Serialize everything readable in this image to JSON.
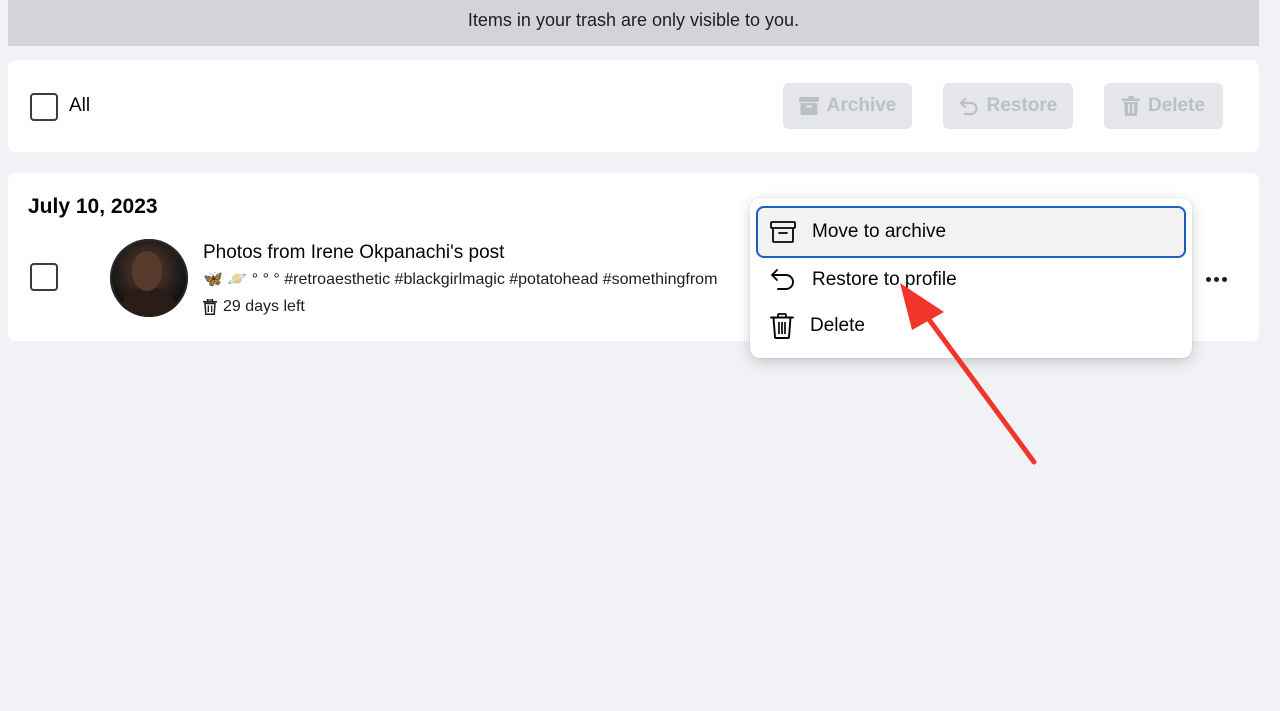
{
  "notice": "Items in your trash are only visible to you.",
  "toolbar": {
    "select_all_label": "All",
    "archive_label": "Archive",
    "restore_label": "Restore",
    "delete_label": "Delete"
  },
  "group": {
    "date": "July 10, 2023",
    "item": {
      "title": "Photos from Irene Okpanachi's post",
      "caption": "🦋 🪐 ° ° ° #retroaesthetic #blackgirlmagic #potatohead #somethingfrom",
      "days_left": "29 days left"
    }
  },
  "menu": {
    "items": [
      {
        "label": "Move to archive",
        "icon": "archive-box-icon"
      },
      {
        "label": "Restore to profile",
        "icon": "undo-arrow-icon"
      },
      {
        "label": "Delete",
        "icon": "trash-icon"
      }
    ]
  },
  "colors": {
    "page_bg": "#f0f2f5",
    "notice_bg": "#d3d4d8",
    "disabled_button_bg": "#e4e6eb",
    "disabled_button_text": "#bcc0c4",
    "focus_ring": "#1f5fbf",
    "annotation_arrow": "#f1352a"
  }
}
